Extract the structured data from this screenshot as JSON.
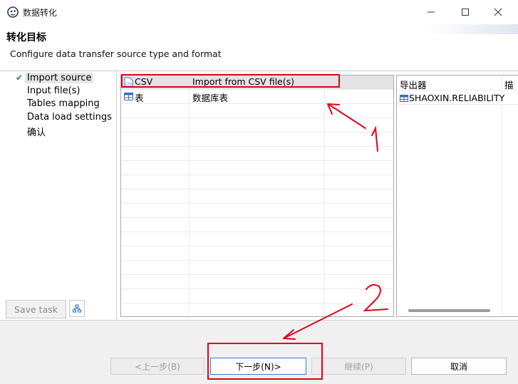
{
  "window": {
    "title": "数据转化",
    "controls": {
      "minimize": "—",
      "maximize": "☐",
      "close": "✕"
    }
  },
  "header": {
    "title": "转化目标",
    "subtitle": "Configure data transfer source type and format"
  },
  "nav": {
    "items": [
      {
        "label": "Import source",
        "active": true,
        "checked": true
      },
      {
        "label": "Input file(s)"
      },
      {
        "label": "Tables mapping"
      },
      {
        "label": "Data load settings"
      },
      {
        "label": "确认"
      }
    ],
    "save_task_label": "Save task"
  },
  "source_table": {
    "rows": [
      {
        "name": "CSV",
        "description": "Import from CSV file(s)",
        "icon": "csv-file-icon",
        "selected": true
      },
      {
        "name": "表",
        "description": "数据库表",
        "icon": "table-icon"
      }
    ]
  },
  "target_table": {
    "header": "导出器",
    "header_cut": "描",
    "rows": [
      {
        "name": "SHAOXIN.RELIABILITY",
        "icon": "table-icon"
      }
    ]
  },
  "buttons": {
    "back": "<上一步(B)",
    "next": "下一步(N)>",
    "continue": "继续(P)",
    "cancel": "取消"
  },
  "annotations": {
    "color": "#e2001a"
  }
}
